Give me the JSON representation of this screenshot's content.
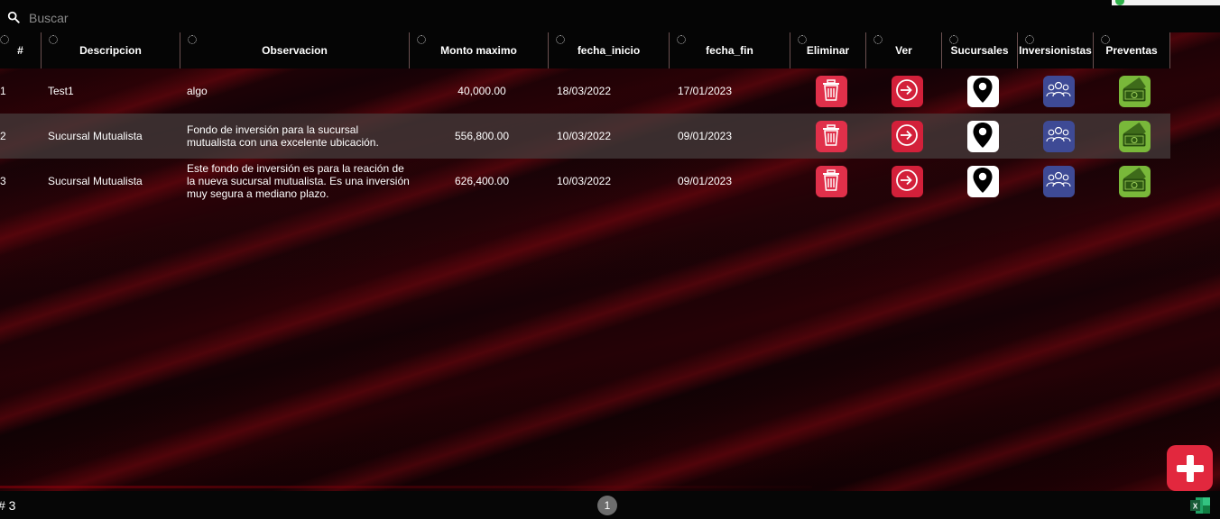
{
  "search": {
    "placeholder": "Buscar"
  },
  "table": {
    "columns": [
      "#",
      "Descripcion",
      "Observacion",
      "Monto maximo",
      "fecha_inicio",
      "fecha_fin",
      "Eliminar",
      "Ver",
      "Sucursales",
      "Inversionistas",
      "Preventas"
    ],
    "rows": [
      {
        "id": "1",
        "descripcion": "Test1",
        "observacion_lines": [
          "algo"
        ],
        "monto": "40,000.00",
        "inicio": "18/03/2022",
        "fin": "17/01/2023"
      },
      {
        "id": "2",
        "descripcion": "Sucursal Mutualista",
        "observacion_lines": [
          "Fondo de inversión para la sucursal",
          "mutualista con una excelente ubicación."
        ],
        "monto": "556,800.00",
        "inicio": "10/03/2022",
        "fin": "09/01/2023"
      },
      {
        "id": "3",
        "descripcion": "Sucursal Mutualista",
        "observacion_lines": [
          "Este fondo de inversión es para la reación de",
          "la nueva sucursal mutualista. Es una inversión",
          "muy segura a mediano plazo."
        ],
        "monto": "626,400.00",
        "inicio": "10/03/2022",
        "fin": "09/01/2023"
      }
    ]
  },
  "footer": {
    "count": "# 3",
    "page": "1"
  },
  "colors": {
    "delete": "#e0304a",
    "view": "#d3203a",
    "branches": "#ffffff",
    "investors": "#3e4a95",
    "presales": "#79b83a",
    "fab": "#e2283e"
  },
  "icons": {
    "delete": "trash-icon",
    "view": "enter-arrow-icon",
    "branches": "location-pin-icon",
    "investors": "group-icon",
    "presales": "money-bills-icon",
    "add": "plus-icon",
    "export": "excel-icon"
  }
}
